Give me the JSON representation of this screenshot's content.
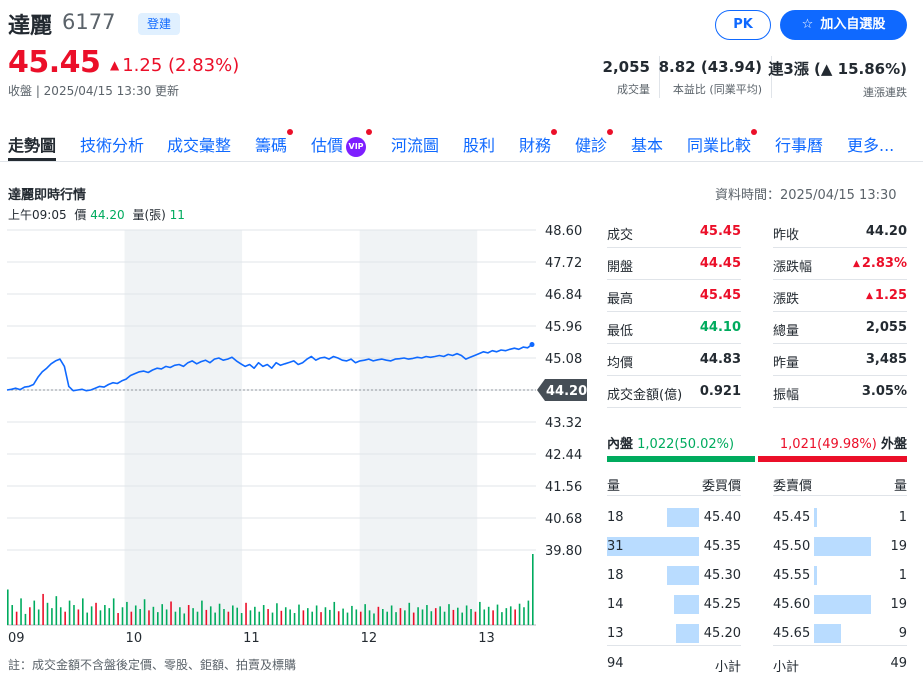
{
  "header": {
    "name": "達麗",
    "code": "6177",
    "market": "登建",
    "pk_label": "PK",
    "watch_label": "加入自選股",
    "price": "45.45",
    "change": "1.25 (2.83%)",
    "status": "收盤 | 2025/04/15 13:30 更新"
  },
  "stats": [
    {
      "value": "2,055",
      "label": "成交量"
    },
    {
      "value": "8.82 (43.94)",
      "label": "本益比 (同業平均)"
    },
    {
      "value": "連3漲 (▲ 15.86%)",
      "label": "連漲連跌"
    }
  ],
  "tabs": [
    "走勢圖",
    "技術分析",
    "成交彙整",
    "籌碼",
    "估價",
    "河流圖",
    "股利",
    "財務",
    "健診",
    "基本",
    "同業比較",
    "行事曆",
    "更多..."
  ],
  "vip_label": "VIP",
  "chart_section": {
    "title": "達麗即時行情",
    "data_time": "資料時間：2025/04/15 13:30",
    "hover_time": "上午09:05",
    "hover_price_label": "價",
    "hover_price": "44.20",
    "hover_vol_label": "量(張)",
    "hover_vol": "11"
  },
  "quote_left": [
    {
      "k": "成交",
      "v": "45.45",
      "c": "up"
    },
    {
      "k": "開盤",
      "v": "44.45",
      "c": "up"
    },
    {
      "k": "最高",
      "v": "45.45",
      "c": "up"
    },
    {
      "k": "最低",
      "v": "44.10",
      "c": "dn"
    },
    {
      "k": "均價",
      "v": "44.83",
      "c": ""
    },
    {
      "k": "成交金額(億)",
      "v": "0.921",
      "c": ""
    }
  ],
  "quote_right": [
    {
      "k": "昨收",
      "v": "44.20",
      "c": ""
    },
    {
      "k": "漲跌幅",
      "v": "2.83%",
      "c": "up",
      "tri": true
    },
    {
      "k": "漲跌",
      "v": "1.25",
      "c": "up",
      "tri": true
    },
    {
      "k": "總量",
      "v": "2,055",
      "c": ""
    },
    {
      "k": "昨量",
      "v": "3,485",
      "c": ""
    },
    {
      "k": "振幅",
      "v": "3.05%",
      "c": ""
    }
  ],
  "inout": {
    "in_label": "內盤",
    "in_value": "1,022(50.02%)",
    "out_value": "1,021(49.98%)",
    "out_label": "外盤",
    "in_ratio": 0.5002
  },
  "orderbook": {
    "bid_qty_header": "量",
    "bid_price_header": "委買價",
    "ask_price_header": "委賣價",
    "ask_qty_header": "量",
    "bids": [
      {
        "qty": "18",
        "price": "45.40"
      },
      {
        "qty": "31",
        "price": "45.35"
      },
      {
        "qty": "18",
        "price": "45.30"
      },
      {
        "qty": "14",
        "price": "45.25"
      },
      {
        "qty": "13",
        "price": "45.20"
      }
    ],
    "asks": [
      {
        "qty": "1",
        "price": "45.45"
      },
      {
        "qty": "19",
        "price": "45.50"
      },
      {
        "qty": "1",
        "price": "45.55"
      },
      {
        "qty": "19",
        "price": "45.60"
      },
      {
        "qty": "9",
        "price": "45.65"
      }
    ],
    "bid_total": "94",
    "subtotal_label": "小計",
    "ask_total": "49"
  },
  "note": "註：成交金額不含盤後定價、零股、鉅額、拍賣及標購",
  "colors": {
    "up": "#eb0f29",
    "down": "#00ab5e",
    "line": "#0f69ff",
    "accent": "#0f69ff"
  },
  "chart_data": {
    "type": "line",
    "x_ticks": [
      "09",
      "10",
      "11",
      "12",
      "13"
    ],
    "y_ticks": [
      "48.60",
      "47.72",
      "46.84",
      "45.96",
      "45.08",
      "44.20",
      "43.32",
      "42.44",
      "41.56",
      "40.68",
      "39.80"
    ],
    "ylim": [
      39.8,
      48.6
    ],
    "prev_close": 44.2,
    "current_label": "44.20",
    "grid": true,
    "series": [
      {
        "values": [
          44.2,
          44.22,
          44.25,
          44.21,
          44.28,
          44.3,
          44.35,
          44.55,
          44.7,
          44.8,
          44.92,
          45.0,
          45.05,
          44.85,
          44.3,
          44.18,
          44.2,
          44.22,
          44.18,
          44.2,
          44.25,
          44.3,
          44.28,
          44.35,
          44.4,
          44.38,
          44.45,
          44.5,
          44.6,
          44.65,
          44.7,
          44.72,
          44.68,
          44.75,
          44.8,
          44.78,
          44.85,
          44.82,
          44.88,
          44.9,
          44.85,
          44.95,
          45.0,
          44.92,
          44.98,
          45.02,
          44.95,
          45.05,
          45.08,
          45.02,
          45.05,
          45.1,
          45.0,
          44.92,
          44.85,
          44.9,
          44.8,
          44.95,
          44.85,
          44.9,
          44.8,
          44.95,
          44.88,
          44.92,
          44.96,
          45.0,
          44.9,
          44.95,
          45.05,
          45.12,
          45.02,
          45.08,
          45.1,
          45.05,
          45.12,
          45.08,
          45.02,
          45.0,
          45.05,
          44.95,
          45.0,
          45.02,
          45.05,
          45.0,
          45.03,
          45.05,
          45.02,
          45.0,
          45.05,
          45.06,
          45.08,
          45.05,
          45.07,
          45.1,
          45.08,
          45.12,
          45.1,
          45.12,
          45.15,
          45.12,
          45.18,
          45.15,
          45.2,
          45.15,
          45.05,
          45.1,
          45.15,
          45.2,
          45.25,
          45.22,
          45.28,
          45.25,
          45.3,
          45.28,
          45.32,
          45.35,
          45.32,
          45.38,
          45.36,
          45.45
        ]
      }
    ],
    "volumes": [
      80,
      45,
      30,
      60,
      25,
      40,
      55,
      35,
      70,
      50,
      38,
      65,
      40,
      30,
      55,
      45,
      35,
      60,
      28,
      42,
      50,
      33,
      45,
      38,
      60,
      27,
      40,
      52,
      30,
      44,
      36,
      58,
      33,
      41,
      29,
      47,
      35,
      53,
      30,
      40,
      26,
      45,
      38,
      30,
      55,
      34,
      42,
      28,
      48,
      36,
      30,
      44,
      39,
      27,
      50,
      33,
      41,
      30,
      45,
      36,
      28,
      49,
      32,
      40,
      35,
      27,
      46,
      33,
      38,
      30,
      44,
      29,
      40,
      34,
      52,
      31,
      37,
      28,
      43,
      35,
      30,
      47,
      33,
      26,
      41,
      36,
      30,
      44,
      29,
      38,
      33,
      50,
      28,
      40,
      35,
      45,
      31,
      38,
      42,
      30,
      47,
      34,
      39,
      28,
      44,
      36,
      30,
      52,
      35,
      41,
      33,
      46,
      29,
      38,
      42,
      35,
      48,
      40,
      55,
      160
    ],
    "volume_up_mask": [
      0,
      0,
      1,
      0,
      0,
      1,
      0,
      0,
      1,
      0,
      0,
      0,
      0,
      1,
      0,
      0,
      1,
      0,
      0,
      0,
      1,
      0,
      0,
      0,
      0,
      1,
      0,
      0,
      1,
      0,
      0,
      0,
      1,
      0,
      0,
      0,
      0,
      1,
      0,
      0,
      0,
      1,
      0,
      0,
      0,
      1,
      0,
      0,
      0,
      0,
      1,
      0,
      0,
      0,
      1,
      0,
      0,
      0,
      0,
      1,
      0,
      0,
      1,
      0,
      0,
      0,
      0,
      1,
      0,
      0,
      0,
      1,
      0,
      0,
      0,
      1,
      0,
      0,
      0,
      0,
      1,
      0,
      0,
      0,
      1,
      0,
      0,
      0,
      0,
      1,
      0,
      0,
      1,
      0,
      0,
      0,
      0,
      1,
      0,
      0,
      0,
      1,
      0,
      0,
      0,
      0,
      1,
      0,
      0,
      0,
      1,
      0,
      0,
      0,
      0,
      1,
      0,
      0,
      0,
      0
    ]
  }
}
